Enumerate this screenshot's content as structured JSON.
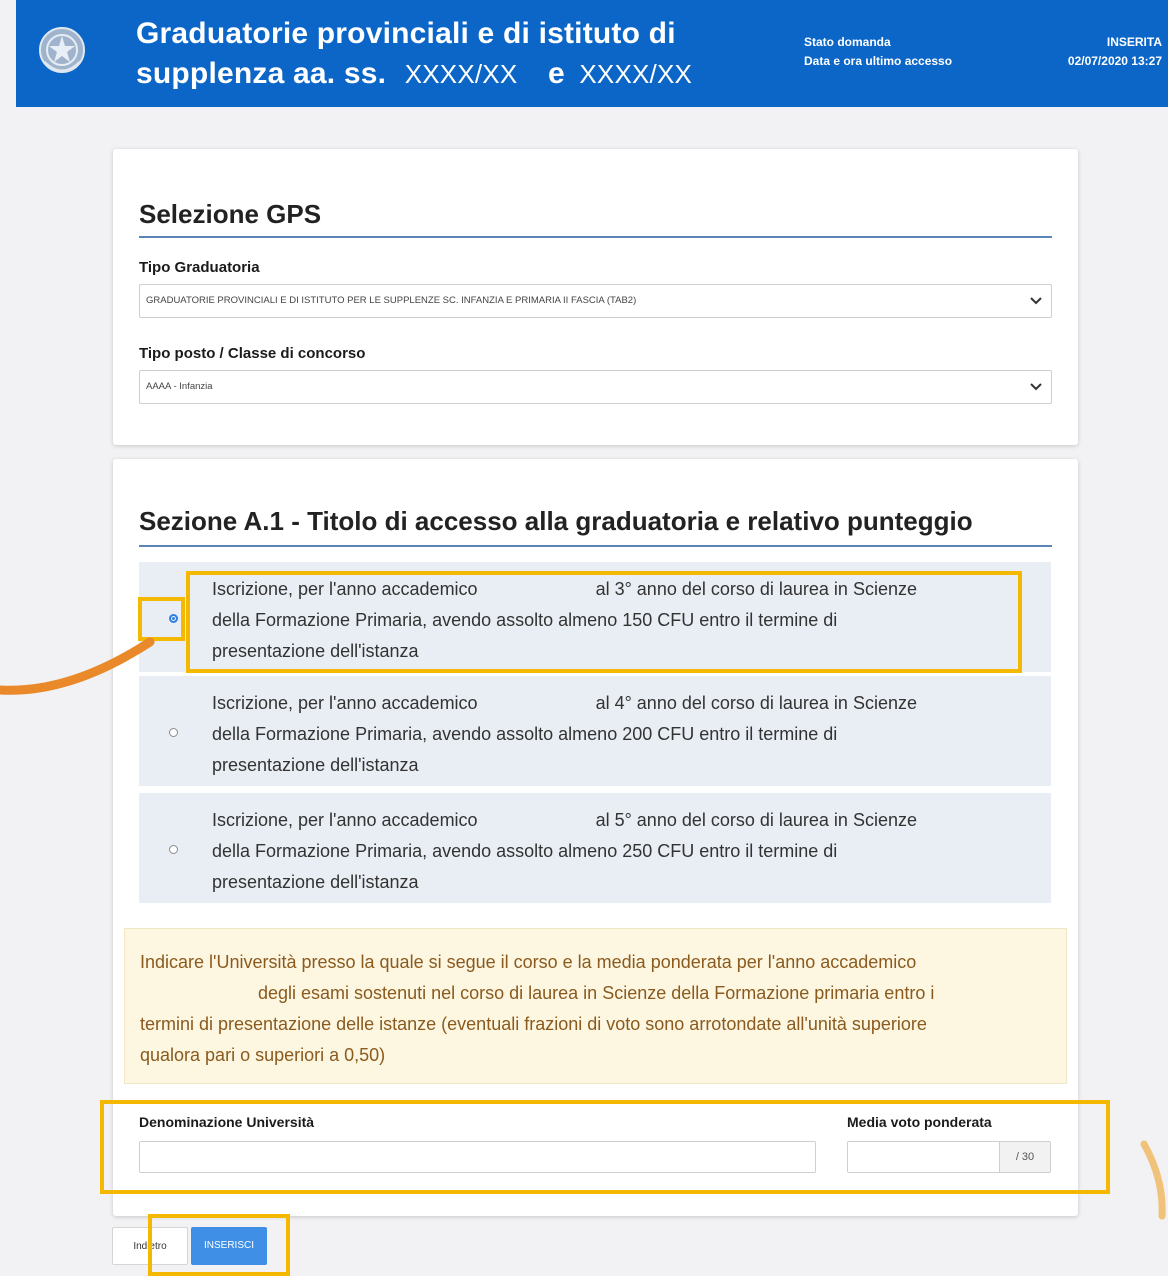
{
  "header": {
    "title_line1": "Graduatorie provinciali e di istituto di",
    "title_line2_prefix": "supplenza aa. ss.",
    "title_line2_code1": "XXXX/XX",
    "title_line2_join": "e",
    "title_line2_code2": "XXXX/XX",
    "status_label": "Stato domanda",
    "status_value": "INSERITA",
    "last_access_label": "Data e ora ultimo accesso",
    "last_access_value": "02/07/2020 13:27",
    "background_color": "#0b66c8"
  },
  "selection": {
    "title": "Selezione GPS",
    "tipo_graduatoria_label": "Tipo Graduatoria",
    "tipo_graduatoria_value": "GRADUATORIE PROVINCIALI E DI ISTITUTO PER LE SUPPLENZE SC. INFANZIA E PRIMARIA II FASCIA (TAB2)",
    "classe_label": "Tipo posto / Classe di concorso",
    "classe_value": "AAAA - Infanzia"
  },
  "section_a1": {
    "title": "Sezione A.1 - Titolo di accesso alla graduatoria e relativo punteggio",
    "options": [
      {
        "line1a": "Iscrizione, per l'anno accademico",
        "line1b": "al 3° anno del corso di laurea in Scienze",
        "line2": "della Formazione Primaria, avendo assolto almeno 150 CFU entro il termine di",
        "line3": "presentazione dell'istanza",
        "selected": true
      },
      {
        "line1a": "Iscrizione, per l'anno accademico",
        "line1b": "al 4° anno del corso di laurea in Scienze",
        "line2": "della Formazione Primaria, avendo assolto almeno 200 CFU entro il termine di",
        "line3": "presentazione dell'istanza",
        "selected": false
      },
      {
        "line1a": "Iscrizione, per l'anno accademico",
        "line1b": "al 5° anno del corso di laurea in Scienze",
        "line2": "della Formazione Primaria, avendo assolto almeno 250 CFU entro il termine di",
        "line3": "presentazione dell'istanza",
        "selected": false
      }
    ],
    "note_line1": "Indicare l'Università presso la quale si segue il corso e la media ponderata per l'anno accademico",
    "note_line2": "degli esami sostenuti nel corso di laurea in Scienze della Formazione primaria entro i",
    "note_line3": "termini di presentazione delle istanze (eventuali frazioni di voto sono arrotondate all'unità superiore",
    "note_line4": "qualora pari o superiori a 0,50)",
    "university_label": "Denominazione Università",
    "university_value": "",
    "media_label": "Media voto ponderata",
    "media_value": "",
    "media_suffix": "/ 30"
  },
  "buttons": {
    "back_label": "Indietro",
    "insert_label": "INSERISCI"
  },
  "colors": {
    "highlight": "#f5b800",
    "accent": "#2f7fe0",
    "note_text": "#8a5a1e"
  }
}
